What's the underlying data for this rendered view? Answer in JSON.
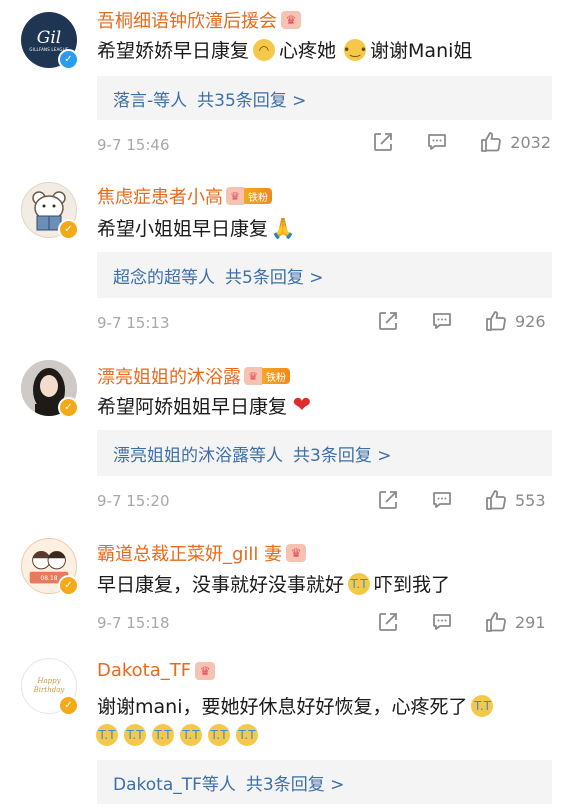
{
  "comments": [
    {
      "username": "吾桐细语钟欣潼后援会",
      "avatar_text": "Gil",
      "avatar_sub": "GILLFANS LEAGUE",
      "verify": "blue",
      "text_a": "希望娇娇早日康复",
      "text_b": "心疼她",
      "text_c": "谢谢Mani姐",
      "reply_users": "落言-等人",
      "reply_count": "共35条回复 >",
      "time": "9-7 15:46",
      "likes": "2032"
    },
    {
      "username": "焦虑症患者小高",
      "fan_label": "铁粉",
      "verify": "gold",
      "text_a": "希望小姐姐早日康复",
      "reply_users": "超念的超等人",
      "reply_count": "共5条回复 >",
      "time": "9-7 15:13",
      "likes": "926"
    },
    {
      "username": "漂亮姐姐的沐浴露",
      "fan_label": "铁粉",
      "verify": "gold",
      "text_a": "希望阿娇姐姐早日康复",
      "reply_users": "漂亮姐姐的沐浴露等人",
      "reply_count": "共3条回复 >",
      "time": "9-7 15:20",
      "likes": "553"
    },
    {
      "username": "霸道总裁正菜妍_gill 妻",
      "avatar_text": "08.18",
      "verify": "gold",
      "text_a": "早日康复，没事就好没事就好",
      "text_b": "吓到我了",
      "time": "9-7 15:18",
      "likes": "291"
    },
    {
      "username": "Dakota_TF",
      "avatar_text": "Happy Birthday",
      "verify": "gold",
      "text_a": "谢谢mani，要她好休息好好恢复，心疼死了",
      "reply_users": "Dakota_TF等人",
      "reply_count": "共3条回复 >"
    }
  ],
  "icons": {
    "repost": "repost-icon",
    "comment": "comment-icon",
    "like": "thumbs-up-icon"
  },
  "colors": {
    "username": "#e86a1a",
    "reply_link": "#3d6fa8",
    "meta": "#a8a8a8"
  }
}
